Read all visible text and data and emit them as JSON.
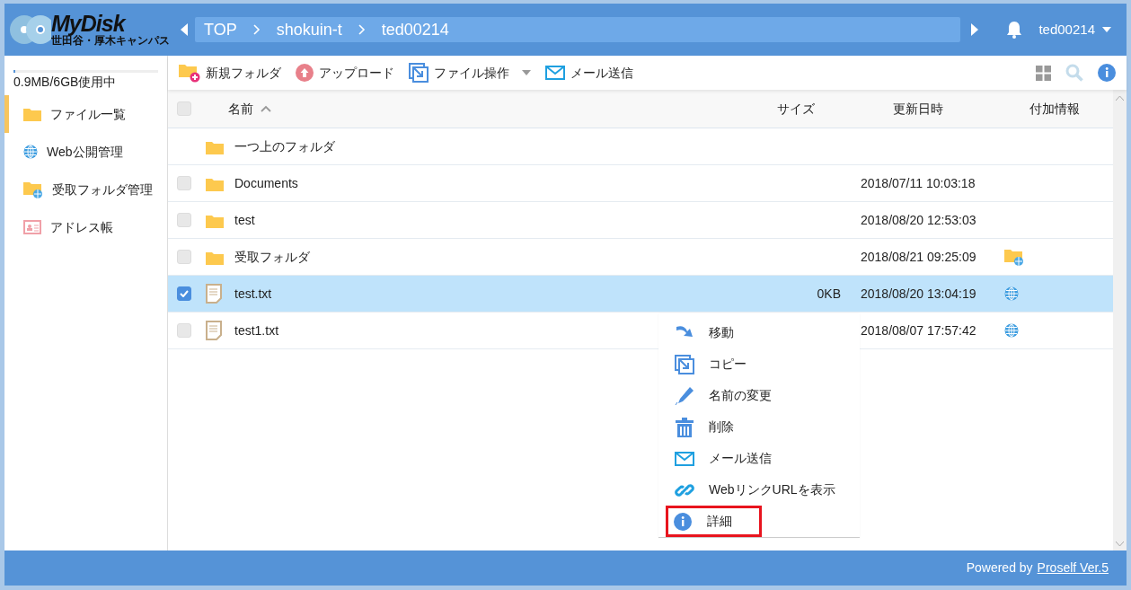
{
  "header": {
    "logo": {
      "title": "MyDisk",
      "subtitle": "世田谷・厚木キャンパス"
    },
    "breadcrumb": [
      "TOP",
      "shokuin-t",
      "ted00214"
    ],
    "user": "ted00214"
  },
  "sidebar": {
    "usage": {
      "level": 0.01,
      "text": "0.9MB/6GB使用中"
    },
    "items": [
      {
        "label": "ファイル一覧",
        "kind": "folder",
        "selected": true
      },
      {
        "label": "Web公開管理",
        "kind": "globe",
        "selected": false
      },
      {
        "label": "受取フォルダ管理",
        "kind": "receive",
        "selected": false
      },
      {
        "label": "アドレス帳",
        "kind": "address",
        "selected": false
      }
    ]
  },
  "toolbar": {
    "actions": [
      {
        "label": "新規フォルダ",
        "kind": "newfolder",
        "dropdown": false
      },
      {
        "label": "アップロード",
        "kind": "upload",
        "dropdown": false
      },
      {
        "label": "ファイル操作",
        "kind": "fileop",
        "dropdown": true
      },
      {
        "label": "メール送信",
        "kind": "mail",
        "dropdown": false
      }
    ]
  },
  "table": {
    "select_all_checked": false,
    "columns": [
      {
        "label": "名前",
        "sorted": true
      },
      {
        "label": "サイズ",
        "sorted": false
      },
      {
        "label": "更新日時",
        "sorted": false
      },
      {
        "label": "付加情報",
        "sorted": false
      }
    ],
    "rows": [
      {
        "kind": "parent",
        "name": "一つ上のフォルダ"
      },
      {
        "kind": "folder",
        "name": "Documents",
        "date": "2018/07/11 10:03:18",
        "checked": false
      },
      {
        "kind": "folder",
        "name": "test",
        "date": "2018/08/20 12:53:03",
        "checked": false
      },
      {
        "kind": "folder",
        "name": "受取フォルダ",
        "date": "2018/08/21 09:25:09",
        "checked": false,
        "extra": {
          "kind": "receive"
        }
      },
      {
        "kind": "file",
        "name": "test.txt",
        "size": "0KB",
        "date": "2018/08/20 13:04:19",
        "checked": true,
        "extra": {
          "kind": "globe"
        }
      },
      {
        "kind": "file",
        "name": "test1.txt",
        "date": "2018/08/07 17:57:42",
        "checked": false,
        "extra": {
          "kind": "globe"
        }
      }
    ]
  },
  "context_menu": {
    "items": [
      {
        "label": "移動",
        "kind": "move",
        "highlighted": false
      },
      {
        "label": "コピー",
        "kind": "copy",
        "highlighted": false
      },
      {
        "label": "名前の変更",
        "kind": "rename",
        "highlighted": false
      },
      {
        "label": "削除",
        "kind": "delete",
        "highlighted": false
      },
      {
        "label": "メール送信",
        "kind": "mail",
        "highlighted": false
      },
      {
        "label": "WebリンクURLを表示",
        "kind": "link",
        "highlighted": false
      },
      {
        "label": "詳細",
        "kind": "info",
        "highlighted": true
      }
    ]
  },
  "footer": {
    "text": "Powered by",
    "link": "Proself Ver.5"
  }
}
